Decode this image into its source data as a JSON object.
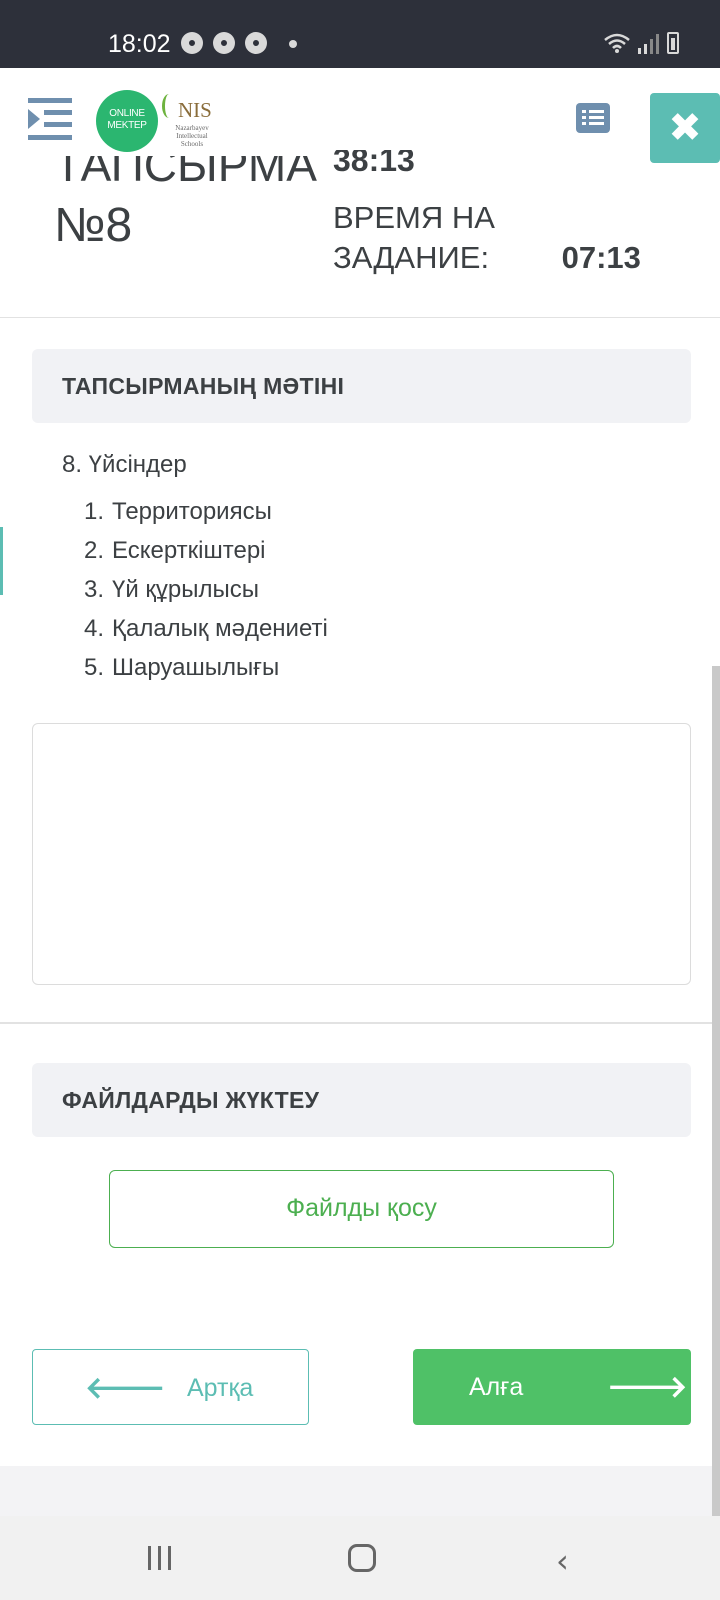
{
  "status_bar": {
    "time": "18:02"
  },
  "header": {
    "logo_online_mektep": "ONLINE MEKTEP",
    "logo_nis": "NIS",
    "logo_nis_sub": "Nazarbayev Intellectual Schools",
    "task_title": "ТАПСЫРМА",
    "task_number": "№8",
    "total_time": "38:13",
    "task_time_label": "ВРЕМЯ НА ЗАДАНИЕ:",
    "task_time_value": "07:13",
    "close_symbol": "✖"
  },
  "task_text": {
    "heading": "ТАПСЫРМАНЫҢ МӘТІНІ",
    "question": "8. Үйсіндер",
    "options": [
      {
        "num": "1.",
        "label": "Территориясы"
      },
      {
        "num": "2.",
        "label": "Ескерткіштері"
      },
      {
        "num": "3.",
        "label": "Үй құрылысы"
      },
      {
        "num": "4.",
        "label": "Қалалық мәдениеті"
      },
      {
        "num": "5.",
        "label": "Шаруашылығы"
      }
    ],
    "answer_value": ""
  },
  "files": {
    "heading": "ФАЙЛДАРДЫ ЖҮКТЕУ",
    "add_file_label": "Файлды қосу"
  },
  "navigation": {
    "back_label": "Артқа",
    "next_label": "Алға",
    "back_arrow": "🡐",
    "next_arrow": "🡒"
  },
  "colors": {
    "accent_green": "#4fc167",
    "accent_teal": "#5cbdb3",
    "icon_blue": "#6f8fae"
  }
}
